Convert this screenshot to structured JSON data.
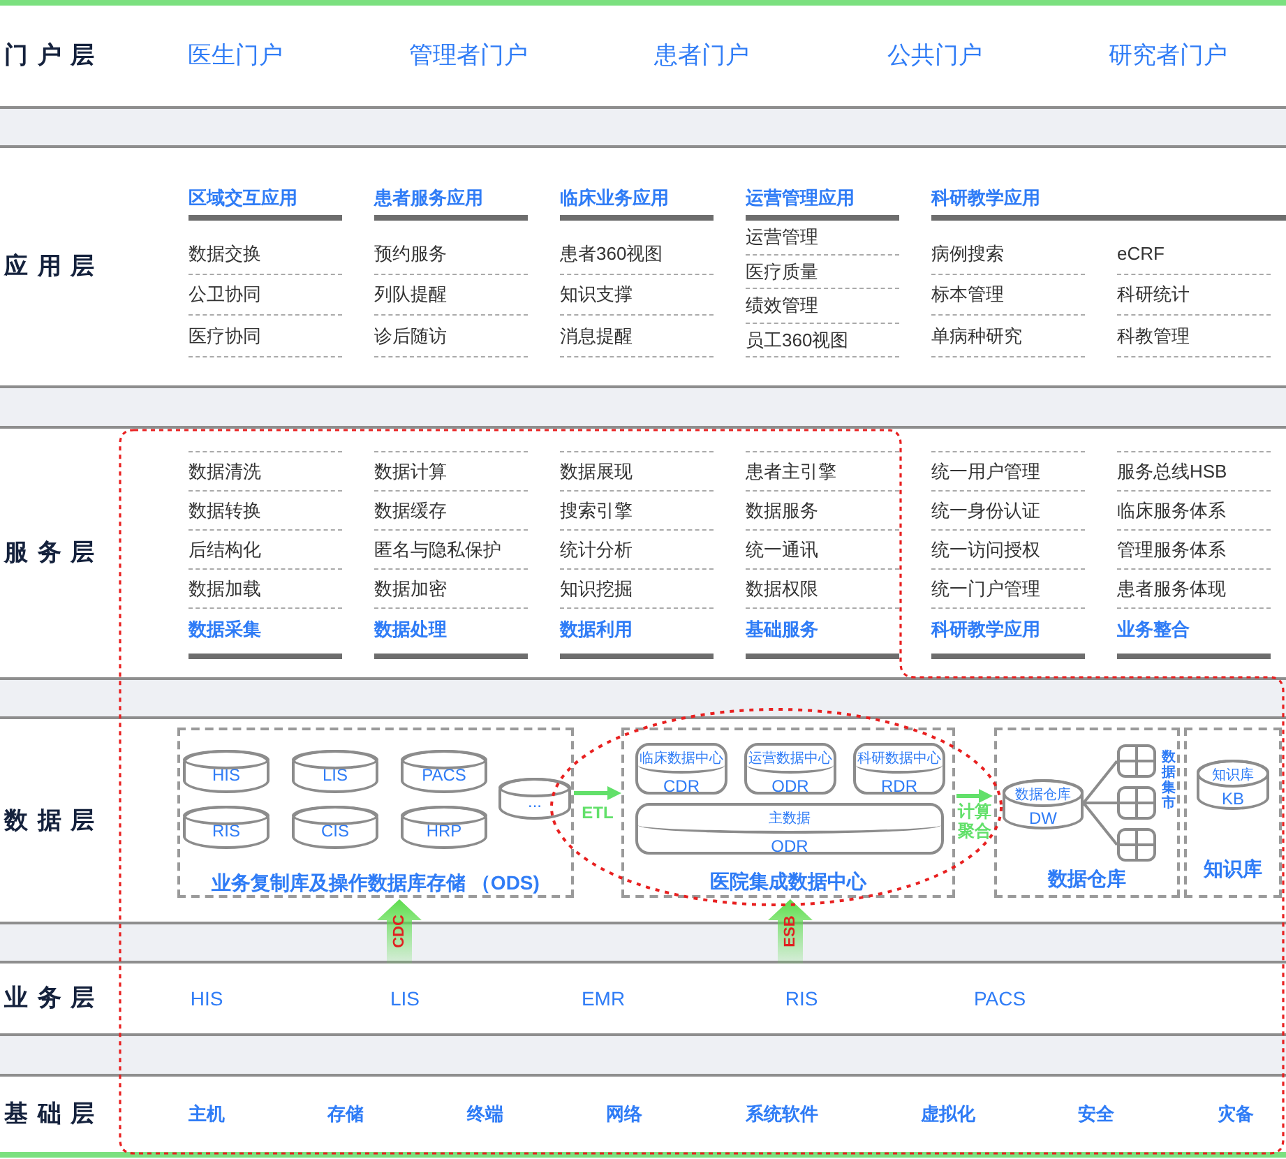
{
  "portal_layer": {
    "label": "门户层",
    "portals": [
      "医生门户",
      "管理者门户",
      "患者门户",
      "公共门户",
      "研究者门户"
    ]
  },
  "application_layer": {
    "label": "应用层",
    "groups": [
      {
        "title": "区域交互应用",
        "columns": [
          [
            "数据交换",
            "公卫协同",
            "医疗协同"
          ]
        ]
      },
      {
        "title": "患者服务应用",
        "columns": [
          [
            "预约服务",
            "列队提醒",
            "诊后随访"
          ]
        ]
      },
      {
        "title": "临床业务应用",
        "columns": [
          [
            "患者360视图",
            "知识支撑",
            "消息提醒"
          ]
        ]
      },
      {
        "title": "运营管理应用",
        "columns": [
          [
            "运营管理",
            "医疗质量",
            "绩效管理",
            "员工360视图"
          ]
        ]
      },
      {
        "title": "科研教学应用",
        "columns": [
          [
            "病例搜索",
            "标本管理",
            "单病种研究"
          ],
          [
            "eCRF",
            "科研统计",
            "科教管理"
          ]
        ]
      }
    ]
  },
  "service_layer": {
    "label": "服务层",
    "groups": [
      {
        "items": [
          "数据清洗",
          "数据转换",
          "后结构化",
          "数据加载"
        ],
        "title": "数据采集"
      },
      {
        "items": [
          "数据计算",
          "数据缓存",
          "匿名与隐私保护",
          "数据加密"
        ],
        "title": "数据处理"
      },
      {
        "items": [
          "数据展现",
          "搜索引擎",
          "统计分析",
          "知识挖掘"
        ],
        "title": "数据利用"
      },
      {
        "items": [
          "患者主引擎",
          "数据服务",
          "统一通讯",
          "数据权限"
        ],
        "title": "基础服务"
      },
      {
        "items": [
          "统一用户管理",
          "统一身份认证",
          "统一访问授权",
          "统一门户管理"
        ],
        "title": "科研教学应用"
      },
      {
        "items": [
          "服务总线HSB",
          "临床服务体系",
          "管理服务体系",
          "患者服务体现"
        ],
        "title": "业务整合"
      }
    ]
  },
  "data_layer": {
    "label": "数据层",
    "ods": {
      "databases": [
        "HIS",
        "LIS",
        "PACS",
        "RIS",
        "CIS",
        "HRP"
      ],
      "more": "...",
      "title": "业务复制库及操作数据库存储 （ODS)"
    },
    "etl_label": "ETL",
    "integration_center": {
      "stores": [
        {
          "caption": "临床数据中心",
          "name": "CDR"
        },
        {
          "caption": "运营数据中心",
          "name": "ODR"
        },
        {
          "caption": "科研数据中心",
          "name": "RDR"
        }
      ],
      "master": {
        "caption": "主数据",
        "name": "ODR"
      },
      "title": "医院集成数据中心"
    },
    "aggregation_label": "计算聚合",
    "warehouse": {
      "caption": "数据仓库",
      "name": "DW",
      "mart_label": "数据集市",
      "title": "数据仓库"
    },
    "knowledge_base": {
      "caption": "知识库",
      "name": "KB",
      "title": "知识库"
    },
    "cdc_label": "CDC",
    "esb_label": "ESB"
  },
  "business_layer": {
    "label": "业务层",
    "systems": [
      "HIS",
      "LIS",
      "EMR",
      "RIS",
      "PACS"
    ]
  },
  "infrastructure_layer": {
    "label": "基础层",
    "items": [
      "主机",
      "存储",
      "终端",
      "网络",
      "系统软件",
      "虚拟化",
      "安全",
      "灾备"
    ]
  }
}
